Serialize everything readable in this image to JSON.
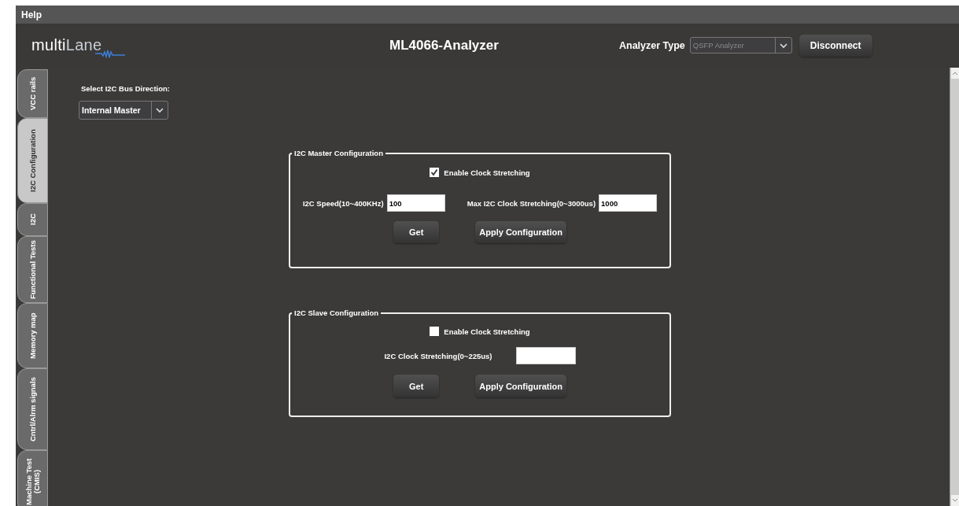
{
  "menu": [
    "Help"
  ],
  "header": {
    "logo": {
      "part_1": "multi",
      "part_2": "Lane"
    },
    "title": "ML4066-Analyzer",
    "analyzer_type": {
      "label": "Analyzer Type",
      "value": "QSFP Analyzer",
      "disabled": true
    },
    "disconnect_button": "Disconnect"
  },
  "tabs": [
    {
      "label": "VCC rails",
      "selected": false
    },
    {
      "label": "I2C Configuration",
      "selected": true
    },
    {
      "label": "I2C",
      "selected": false
    },
    {
      "label": "Functional Tests",
      "selected": false
    },
    {
      "label": "Memory map",
      "selected": false
    },
    {
      "label": "Cntrl/Alrm signals",
      "selected": false
    },
    {
      "label": "Machine Test (CMIS)",
      "selected": false
    }
  ],
  "bus_direction": {
    "label": "Select I2C Bus Direction:",
    "value": "Internal Master"
  },
  "groups": [
    {
      "title": "I2C Master Configuration",
      "clock_stretching": {
        "label": "Enable Clock Stretching",
        "checked": true
      },
      "fields": [
        {
          "label": "I2C Speed(10~400KHz)",
          "value": "100"
        },
        {
          "label": "Max I2C Clock Stretching(0~3000us)",
          "value": "1000"
        }
      ],
      "buttons": [
        "Get",
        "Apply Configuration"
      ]
    },
    {
      "title": "I2C Slave Configuration",
      "clock_stretching": {
        "label": "Enable Clock Stretching",
        "checked": false
      },
      "fields": [
        {
          "label": "I2C Clock Stretching(0~225us)"
        }
      ],
      "buttons": [
        "Get",
        "Apply Configuration"
      ]
    }
  ]
}
